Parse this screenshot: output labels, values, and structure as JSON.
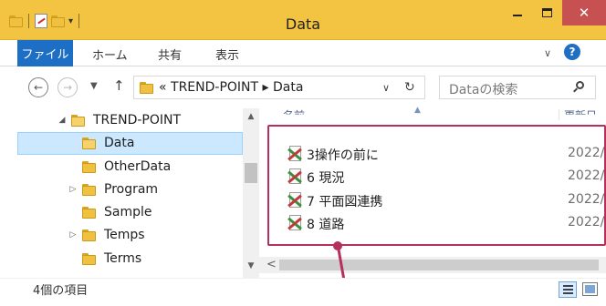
{
  "window": {
    "title": "Data"
  },
  "quick_access": {
    "dropdown_glyph": "▾"
  },
  "window_controls": {
    "close_glyph": "✕"
  },
  "ribbon": {
    "tabs": [
      {
        "label": "ファイル",
        "active": true
      },
      {
        "label": "ホーム"
      },
      {
        "label": "共有"
      },
      {
        "label": "表示"
      }
    ],
    "expand_glyph": "∨",
    "help_glyph": "?"
  },
  "navigation": {
    "back_glyph": "←",
    "forward_glyph": "→",
    "recent_glyph": "▼",
    "up_glyph": "↑",
    "address": {
      "path_text": "« TREND-POINT ▸ Data",
      "segments": [
        "TREND-POINT",
        "Data"
      ],
      "dropdown_glyph": "∨",
      "refresh_glyph": "↻"
    },
    "search": {
      "placeholder": "Dataの検索",
      "icon": "search-icon"
    }
  },
  "tree": {
    "items": [
      {
        "label": "TREND-POINT",
        "arrow": "◢",
        "open": true
      },
      {
        "label": "Data",
        "arrow": "",
        "selected": true
      },
      {
        "label": "OtherData",
        "arrow": ""
      },
      {
        "label": "Program",
        "arrow": "▷"
      },
      {
        "label": "Sample",
        "arrow": ""
      },
      {
        "label": "Temps",
        "arrow": "▷"
      },
      {
        "label": "Terms",
        "arrow": ""
      }
    ],
    "scroll_up_glyph": "▲",
    "scroll_down_glyph": "▼"
  },
  "file_list": {
    "columns": [
      {
        "label": "名前"
      },
      {
        "label": "更新日"
      }
    ],
    "sort_glyph": "▲",
    "files": [
      {
        "name": "3操作の前に",
        "modified": "2022/"
      },
      {
        "name": "6 現況",
        "modified": "2022/"
      },
      {
        "name": "7 平面図連携",
        "modified": "2022/"
      },
      {
        "name": "8 道路",
        "modified": "2022/"
      }
    ],
    "hscroll_left_glyph": "<"
  },
  "status": {
    "item_count": "4個の項目"
  },
  "colors": {
    "titlebar": "#f3c442",
    "file_tab": "#1c6fc4",
    "close_button": "#c75050",
    "highlight": "#b5305a",
    "selection": "#cce8ff"
  }
}
